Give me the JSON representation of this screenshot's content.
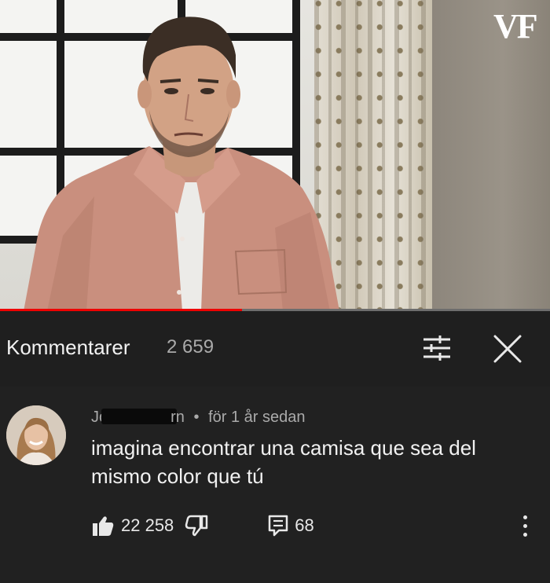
{
  "video": {
    "watermark": "VF",
    "progress_percent": 44,
    "colors": {
      "progress_fill": "#ee0000",
      "progress_track": "#6d6d6d",
      "shirt": "#c98f7e"
    }
  },
  "comments_panel": {
    "title": "Kommentarer",
    "count": "2 659",
    "sort_icon": "sort-sliders-icon",
    "close_icon": "close-x-icon"
  },
  "comment": {
    "author_start": "Jo",
    "author_end": "rn",
    "separator": "•",
    "time": "för 1 år sedan",
    "text": "imagina encontrar una camisa que sea del mismo color que tú",
    "like_count": "22 258",
    "reply_count": "68",
    "icons": {
      "like": "thumbs-up-icon",
      "dislike": "thumbs-down-icon",
      "reply": "comment-icon",
      "more": "more-vertical-icon"
    }
  }
}
